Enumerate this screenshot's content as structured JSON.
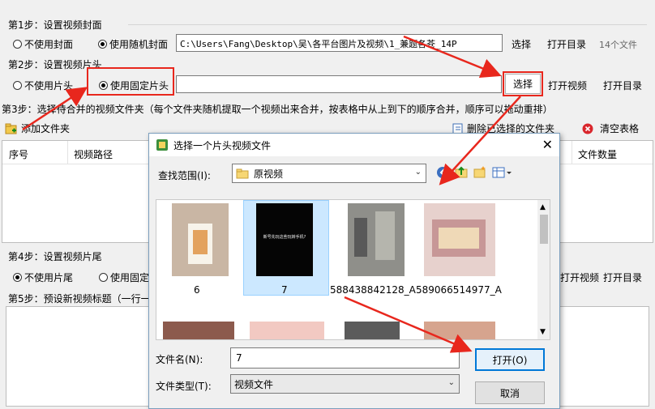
{
  "step1": {
    "title": "第1步：设置视频封面",
    "opt_none": "不使用封面",
    "opt_random": "使用随机封面",
    "path": "C:\\Users\\Fang\\Desktop\\吴\\各平台图片及视频\\1_兼题各苍_14P",
    "choose": "选择",
    "open_dir": "打开目录",
    "count": "14个文件"
  },
  "step2": {
    "title": "第2步：设置视频片头",
    "opt_none": "不使用片头",
    "opt_fixed": "使用固定片头",
    "path": "",
    "choose": "选择",
    "open_video": "打开视频",
    "open_dir": "打开目录"
  },
  "step3": {
    "title": "第3步：选择待合并的视频文件夹（每个文件夹随机提取一个视频出来合并，按表格中从上到下的顺序合并，顺序可以拖动重排）",
    "add_folder": "添加文件夹",
    "delete_selected": "删除已选择的文件夹",
    "clear_table": "清空表格",
    "columns": [
      "序号",
      "视频路径",
      "文件数量"
    ]
  },
  "step4": {
    "title": "第4步：设置视频片尾",
    "opt_none": "不使用片尾",
    "opt_fixed": "使用固定",
    "open_video": "打开视频",
    "open_dir": "打开目录"
  },
  "step5": {
    "title": "第5步：预设新视频标题（一行一"
  },
  "dialog": {
    "title": "选择一个片头视频文件",
    "look_in_label": "查找范围(I):",
    "look_in_value": "原视频",
    "files": [
      {
        "name": "6"
      },
      {
        "name": "7",
        "thumb_text": "新号先玩这些玩转手机?"
      },
      {
        "name": "588438842128_A"
      },
      {
        "name": "589066514977_A"
      }
    ],
    "filename_label": "文件名(N):",
    "filename_value": "7",
    "filetype_label": "文件类型(T):",
    "filetype_value": "视频文件",
    "open_button": "打开(O)",
    "cancel_button": "取消"
  },
  "colors": {
    "highlight_red": "#e8271d",
    "selection_blue": "#cce8ff"
  }
}
